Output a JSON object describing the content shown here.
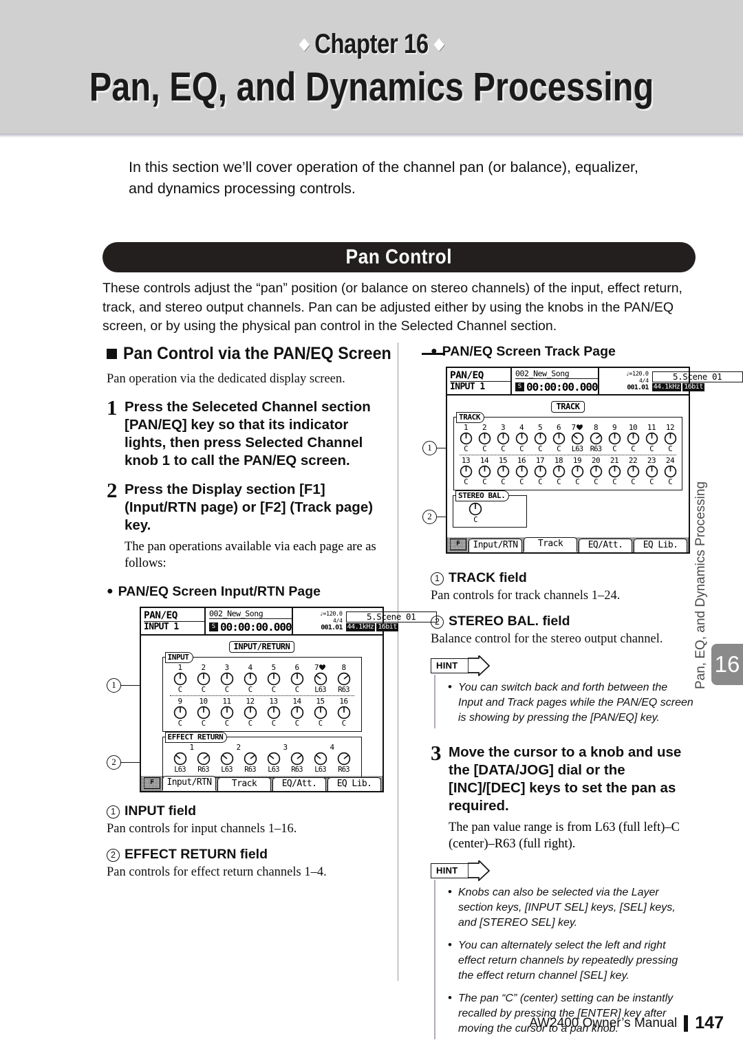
{
  "header": {
    "chapter_prefix": "Chapter",
    "chapter_number": "16",
    "diamond": "◆",
    "title": "Pan, EQ, and Dynamics Processing"
  },
  "intro": "In this section we’ll cover operation of the channel pan (or balance), equalizer, and dynamics processing controls.",
  "section": {
    "banner_title": "Pan Control",
    "body": "These controls adjust the “pan” position (or balance on stereo channels) of the input, effect return, track, and stereo output channels. Pan can be adjusted either by using the knobs in the PAN/EQ screen, or by using the physical pan control in the Selected Channel section."
  },
  "left": {
    "subhead": "Pan Control via the PAN/EQ Screen",
    "subhead_note": "Pan operation via the dedicated display screen.",
    "steps": [
      {
        "num": "1",
        "text": "Press the Seleceted Channel section [PAN/EQ] key so that its indicator lights, then press Selected Channel knob 1 to call the PAN/EQ screen.",
        "sub": ""
      },
      {
        "num": "2",
        "text": "Press the Display section [F1] (Input/RTN page) or [F2] (Track page) key.",
        "sub": "The pan operations available via each page are as follows:"
      }
    ],
    "figure_title": "PAN/EQ Screen Input/RTN Page",
    "fields": [
      {
        "num": "1",
        "title": "INPUT field",
        "desc": "Pan controls for input channels 1–16."
      },
      {
        "num": "2",
        "title": "EFFECT RETURN field",
        "desc": "Pan controls for effect return channels 1–4."
      }
    ]
  },
  "right": {
    "figure_title": "PAN/EQ Screen Track Page",
    "fields": [
      {
        "num": "1",
        "title": "TRACK field",
        "desc": "Pan controls for track channels 1–24."
      },
      {
        "num": "2",
        "title": "STEREO BAL. field",
        "desc": "Balance control for the stereo output channel."
      }
    ],
    "hint1": {
      "label": "HINT",
      "items": [
        "You can switch back and forth between the Input and Track pages while the PAN/EQ screen is showing by pressing the [PAN/EQ] key."
      ]
    },
    "step3": {
      "num": "3",
      "text": "Move the cursor to a knob and use the [DATA/JOG] dial or the [INC]/[DEC] keys to set the pan as required.",
      "sub": "The pan value range is from L63 (full left)–C (center)–R63 (full right)."
    },
    "hint2": {
      "label": "HINT",
      "items": [
        "Knobs can also be selected via the Layer section keys, [INPUT SEL] keys, [SEL] keys, and [STEREO SEL] key.",
        "You can alternately select the left and right effect return channels by repeatedly pressing the effect return channel [SEL] key.",
        "The pan “C” (center) setting can be instantly recalled by pressing the [ENTER] key after moving the cursor to a pan knob."
      ]
    }
  },
  "lcd": {
    "title": "PAN/EQ",
    "channel": "INPUT 1",
    "song": "002_New_Song",
    "timecode": "00:00:00.000",
    "timecode_icon": "S",
    "tempo": "♩=120.0",
    "meter": "4/4",
    "bar": "001.01",
    "scene": "5.Scene 01",
    "samplerate": "44.1kHz",
    "bitdepth": "16bit",
    "tabs": [
      "Input/RTN",
      "Track",
      "EQ/Att.",
      "EQ Lib."
    ],
    "f_key": "F",
    "input_page": {
      "page_label": "INPUT/RETURN",
      "active_tab": "Input/RTN",
      "input_group_label": "INPUT",
      "input_row1": {
        "nums": [
          "1",
          "2",
          "3",
          "4",
          "5",
          "6",
          "7",
          "8"
        ],
        "values": [
          "C",
          "C",
          "C",
          "C",
          "C",
          "C",
          "L63",
          "R63"
        ],
        "heart_after": "7"
      },
      "input_row2": {
        "nums": [
          "9",
          "10",
          "11",
          "12",
          "13",
          "14",
          "15",
          "16"
        ],
        "values": [
          "C",
          "C",
          "C",
          "C",
          "C",
          "C",
          "C",
          "C"
        ]
      },
      "effect_group_label": "EFFECT RETURN",
      "effect_pairs": [
        "1",
        "2",
        "3",
        "4"
      ],
      "effect_values": [
        "L63",
        "R63",
        "L63",
        "R63",
        "L63",
        "R63",
        "L63",
        "R63"
      ]
    },
    "track_page": {
      "page_label": "TRACK",
      "active_tab": "Track",
      "track_group_label": "TRACK",
      "track_row1": {
        "nums": [
          "1",
          "2",
          "3",
          "4",
          "5",
          "6",
          "7",
          "8",
          "9",
          "10",
          "11",
          "12"
        ],
        "values": [
          "C",
          "C",
          "C",
          "C",
          "C",
          "C",
          "L63",
          "R63",
          "C",
          "C",
          "C",
          "C"
        ],
        "heart_after": "7"
      },
      "track_row2": {
        "nums": [
          "13",
          "14",
          "15",
          "16",
          "17",
          "18",
          "19",
          "20",
          "21",
          "22",
          "23",
          "24"
        ],
        "values": [
          "C",
          "C",
          "C",
          "C",
          "C",
          "C",
          "C",
          "C",
          "C",
          "C",
          "C",
          "C"
        ]
      },
      "stereo_group_label": "STEREO BAL.",
      "stereo_value": "C"
    }
  },
  "side_tab": {
    "number": "16",
    "running_title": "Pan, EQ, and Dynamics Processing"
  },
  "footer": {
    "manual": "AW2400  Owner’s Manual",
    "page": "147"
  },
  "colors": {
    "band": "#d0d0d0",
    "banner": "#231f1f",
    "side_tab": "#8a8a8a",
    "hint_rule": "#b3a7bd"
  }
}
